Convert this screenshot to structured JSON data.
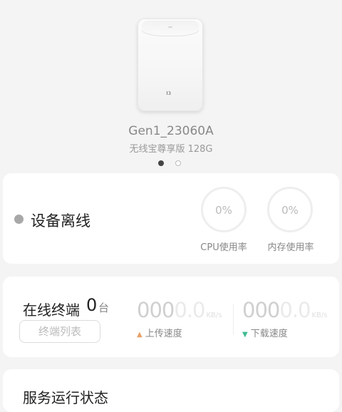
{
  "device": {
    "name": "Gen1_23060A",
    "subtitle": "无线宝尊享版 128G",
    "logo_text": "נו",
    "pager": {
      "count": 2,
      "active_index": 0
    }
  },
  "status": {
    "label": "设备离线",
    "cpu": {
      "value": "0%",
      "label": "CPU使用率"
    },
    "memory": {
      "value": "0%",
      "label": "内存使用率"
    }
  },
  "terminals": {
    "label": "在线终端",
    "count": "0",
    "unit": "台",
    "button_label": "终端列表",
    "upload": {
      "lead": "000",
      "tail": "0.0",
      "unit": "KB/s",
      "label": "上传速度"
    },
    "download": {
      "lead": "000",
      "tail": "0.0",
      "unit": "KB/s",
      "label": "下载速度"
    }
  },
  "service": {
    "title": "服务运行状态"
  },
  "colors": {
    "upload_arrow": "#e7a06a",
    "download_arrow": "#3dbb8f",
    "offline_dot": "#a8a8a8"
  }
}
